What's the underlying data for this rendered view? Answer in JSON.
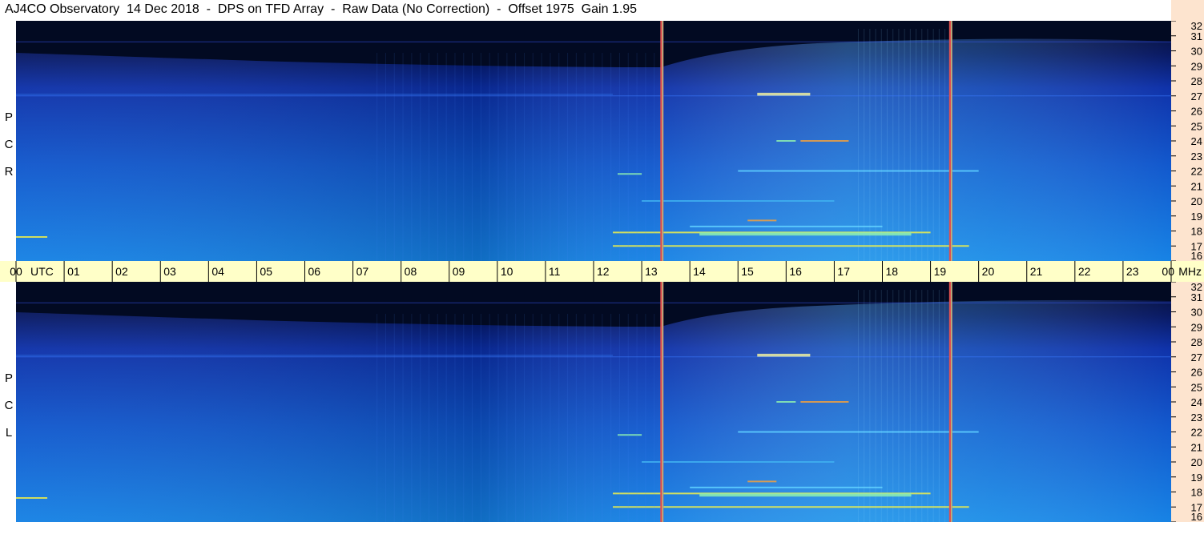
{
  "title": "AJ4CO Observatory  14 Dec 2018  -  DPS on TFD Array  -  Raw Data (No Correction)  -  Offset 1975  Gain 1.95",
  "panels": [
    {
      "id": "rcp",
      "label_letters": [
        "R",
        "C",
        "P"
      ]
    },
    {
      "id": "lcp",
      "label_letters": [
        "L",
        "C",
        "P"
      ]
    }
  ],
  "chart_data": {
    "type": "heatmap",
    "title": "AJ4CO Observatory  14 Dec 2018  -  DPS on TFD Array  -  Raw Data (No Correction)  -  Offset 1975  Gain 1.95",
    "x_axis": {
      "unit_label": "UTC",
      "ticks": [
        "00",
        "01",
        "02",
        "03",
        "04",
        "05",
        "06",
        "07",
        "08",
        "09",
        "10",
        "11",
        "12",
        "13",
        "14",
        "15",
        "16",
        "17",
        "18",
        "19",
        "20",
        "21",
        "22",
        "23",
        "00"
      ],
      "range_hours": [
        0,
        24
      ]
    },
    "y_axis": {
      "unit_label": "MHz",
      "ticks": [
        "16",
        "17",
        "18",
        "19",
        "20",
        "21",
        "22",
        "23",
        "24",
        "25",
        "26",
        "27",
        "28",
        "29",
        "30",
        "31",
        "32"
      ],
      "range_mhz": [
        16,
        32
      ]
    },
    "markers_utc_hours": [
      13.42,
      19.42
    ],
    "colors": {
      "background_dark": "#020a2a",
      "low": "#0a2ea8",
      "mid": "#0f6ad8",
      "high": "#22b8f0",
      "hot": "#f0f04a",
      "marker": "#e05050",
      "time_axis_bg": "#ffffc8",
      "freq_axis_bg": "#fde4cf"
    }
  }
}
